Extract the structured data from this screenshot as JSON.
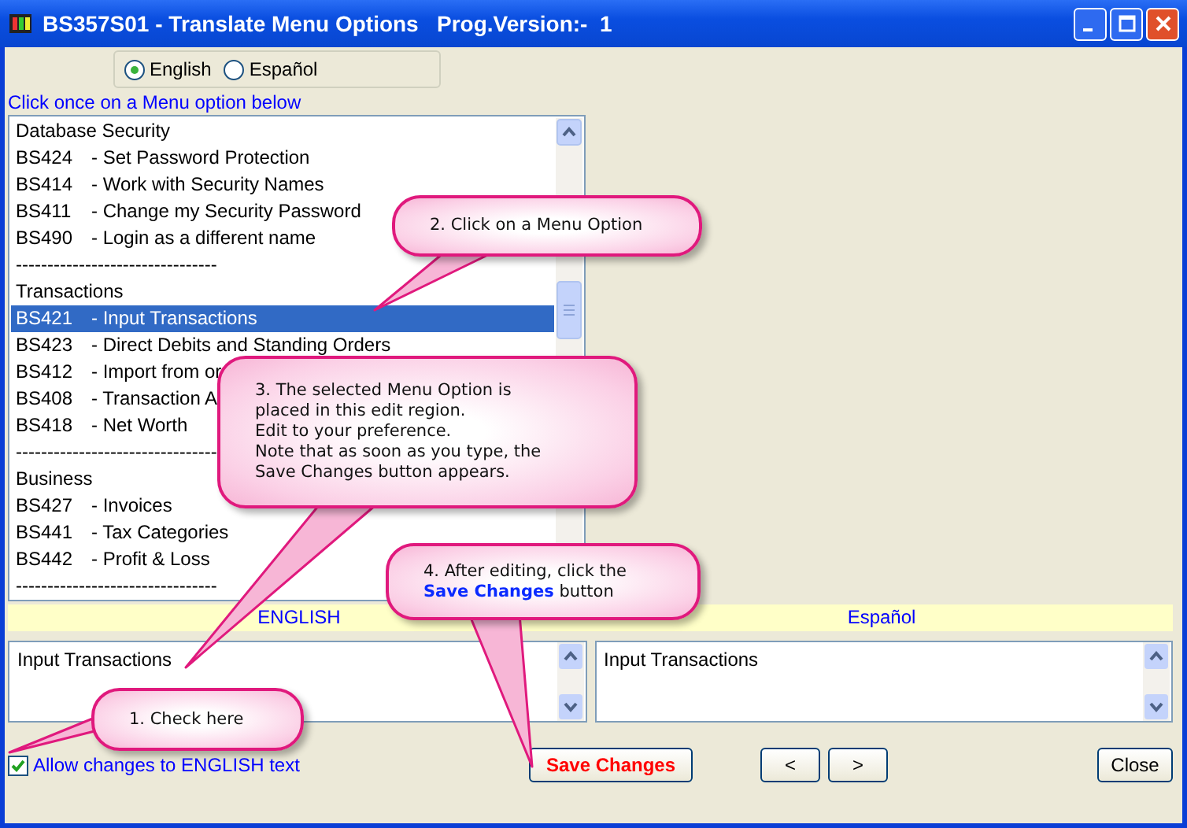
{
  "window": {
    "title": "BS357S01 - Translate Menu Options   Prog.Version:-  1"
  },
  "language": [
    {
      "label": "English",
      "selected": true
    },
    {
      "label": "Español",
      "selected": false
    }
  ],
  "instruction": "Click once on a Menu option below",
  "menu_list": [
    {
      "kind": "heading",
      "text": "Database Security"
    },
    {
      "kind": "option",
      "code": "BS424",
      "text": "- Set Password Protection",
      "selected": false
    },
    {
      "kind": "option",
      "code": "BS414",
      "text": "- Work with Security Names",
      "selected": false
    },
    {
      "kind": "option",
      "code": "BS411",
      "text": "- Change my Security Password",
      "selected": false
    },
    {
      "kind": "option",
      "code": "BS490",
      "text": "- Login as a different name",
      "selected": false
    },
    {
      "kind": "separator",
      "text": "--------------------------------"
    },
    {
      "kind": "heading",
      "text": "Transactions"
    },
    {
      "kind": "option",
      "code": "BS421",
      "text": "- Input Transactions",
      "selected": true
    },
    {
      "kind": "option",
      "code": "BS423",
      "text": "- Direct Debits and Standing Orders",
      "selected": false
    },
    {
      "kind": "option",
      "code": "BS412",
      "text": "- Import from or",
      "selected": false
    },
    {
      "kind": "option",
      "code": "BS408",
      "text": "- Transaction A",
      "selected": false
    },
    {
      "kind": "option",
      "code": "BS418",
      "text": "- Net Worth",
      "selected": false
    },
    {
      "kind": "separator",
      "text": "--------------------------------"
    },
    {
      "kind": "heading",
      "text": "Business"
    },
    {
      "kind": "option",
      "code": "BS427",
      "text": "- Invoices",
      "selected": false
    },
    {
      "kind": "option",
      "code": "BS441",
      "text": "- Tax Categories",
      "selected": false
    },
    {
      "kind": "option",
      "code": "BS442",
      "text": "- Profit & Loss",
      "selected": false
    },
    {
      "kind": "separator",
      "text": "--------------------------------"
    }
  ],
  "editors": [
    {
      "heading": "ENGLISH",
      "value": "Input Transactions"
    },
    {
      "heading": "Español",
      "value": "Input Transactions"
    }
  ],
  "allow_changes": {
    "label": "Allow changes to ENGLISH text",
    "checked": true
  },
  "buttons": {
    "save": "Save Changes",
    "previous": "<",
    "next": ">",
    "close": "Close"
  },
  "callouts": [
    {
      "lines": [
        "2. Click on a Menu Option"
      ]
    },
    {
      "lines": [
        "3. The selected Menu Option is",
        "placed in this edit region.",
        "Edit to your preference.",
        "Note that as soon as you type, the",
        "Save Changes button appears."
      ]
    },
    {
      "lines": [
        "4. After editing, click the",
        "**Save Changes** button"
      ]
    },
    {
      "lines": [
        "1. Check here"
      ]
    }
  ]
}
